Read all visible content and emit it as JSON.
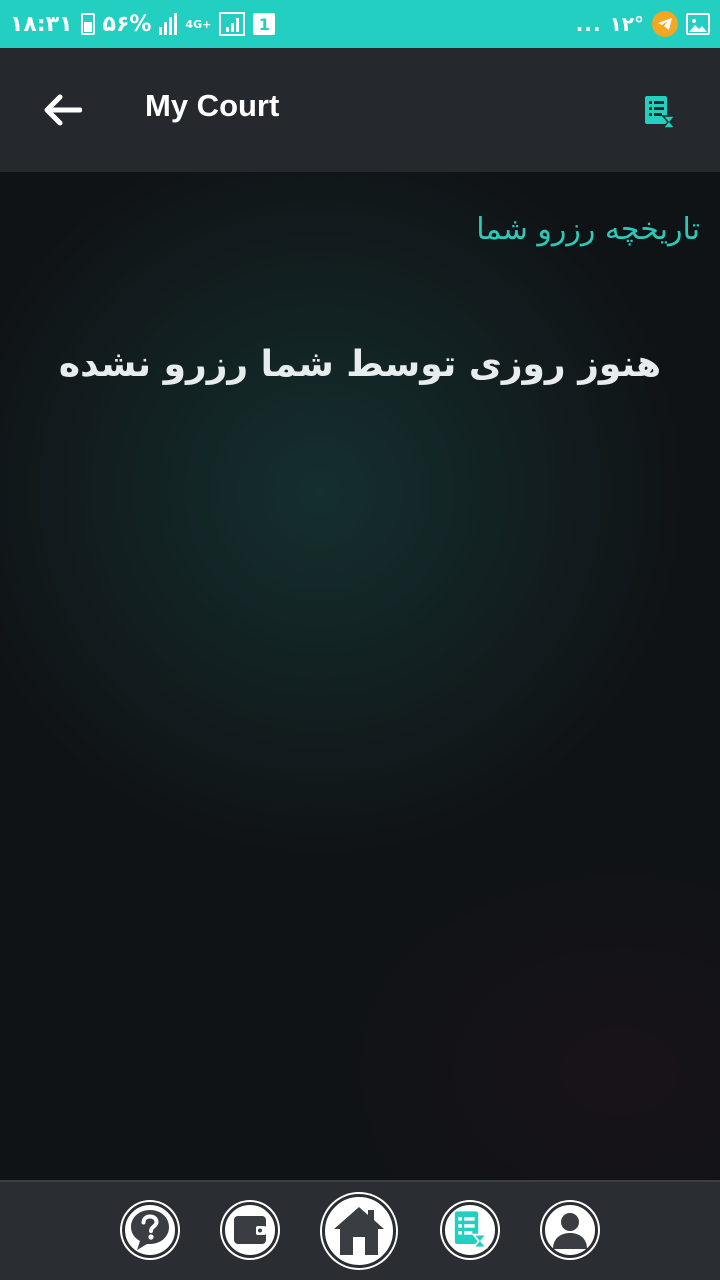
{
  "status_bar": {
    "time": "۱۸:۳۱",
    "battery": "۵۶%",
    "network_type": "4G+",
    "sim_slot": "1",
    "overflow": "...",
    "temperature": "۱۲°",
    "icons": [
      "battery-icon",
      "signal-icon",
      "boxed-signal-icon",
      "sim-icon",
      "telegram-icon",
      "image-icon"
    ]
  },
  "app_bar": {
    "title": "My Court",
    "back_icon": "arrow-left-icon",
    "action_icon": "list-hourglass-icon"
  },
  "content": {
    "heading": "تاریخچه رزرو شما",
    "empty_message": "هنوز روزی توسط شما رزرو نشده"
  },
  "bottom_nav": {
    "items": [
      {
        "name": "help",
        "icon": "question-bubble-icon"
      },
      {
        "name": "wallet",
        "icon": "wallet-icon"
      },
      {
        "name": "home",
        "icon": "home-icon"
      },
      {
        "name": "reservations",
        "icon": "list-hourglass-icon"
      },
      {
        "name": "profile",
        "icon": "user-icon"
      }
    ]
  },
  "colors": {
    "accent": "#22cfc0",
    "app_bar": "#25292d",
    "background": "#101316",
    "nav_bar": "#2a2d31",
    "text": "#e9ecee"
  }
}
